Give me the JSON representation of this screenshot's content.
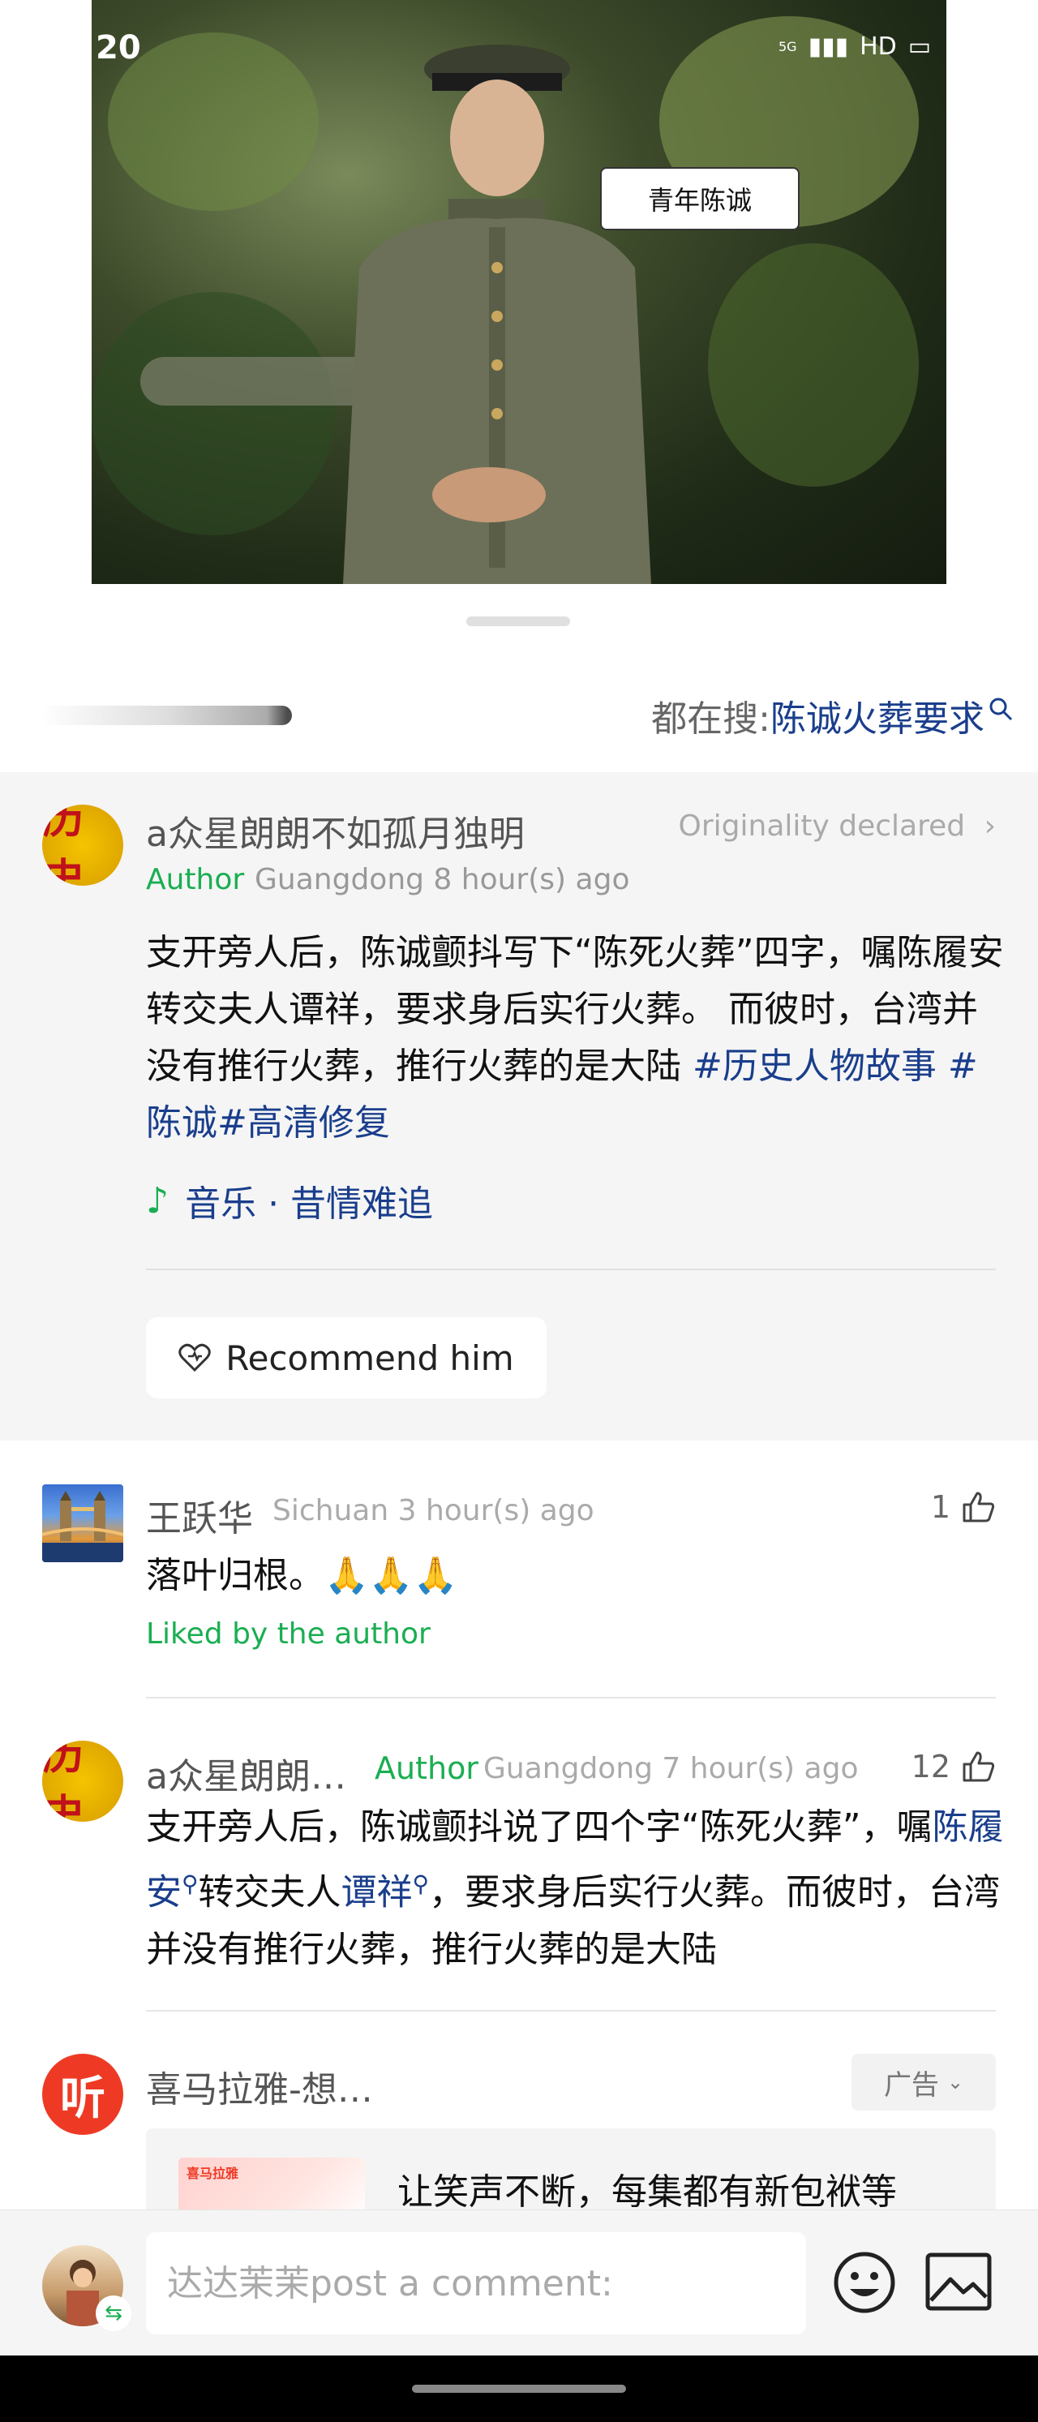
{
  "status_bar": {
    "time": "20",
    "network": "5G",
    "hd": "HD"
  },
  "video": {
    "caption": "青年陈诚"
  },
  "search": {
    "prefix": "都在搜: ",
    "query": "陈诚火葬要求",
    "icon": "search-icon"
  },
  "main_comment": {
    "name": "a众星朗朗不如孤月独明",
    "avatar_char": "历史",
    "originality": "Originality declared",
    "originality_chevron": "›",
    "author_tag": "Author",
    "meta": "Guangdong 8 hour(s) ago",
    "body_text": "支开旁人后，陈诚颤抖写下“陈死火葬”四字，嘱陈履安转交夫人谭祥，要求身后实行火葬。 而彼时，台湾并没有推行火葬，推行火葬的是大陆 ",
    "tag1": "#历史人物故事",
    "tag2": " #陈诚",
    "tag3": "#高清修复",
    "music": "音乐 · 昔情难追",
    "recommend": "Recommend him"
  },
  "comment1": {
    "name": "王跃华",
    "meta": "Sichuan 3 hour(s) ago",
    "likes": "1",
    "body": "落叶归根。🙏🙏🙏",
    "liked_by_author": "Liked by the author"
  },
  "comment2": {
    "name": "a众星朗朗…",
    "author_tag": "Author",
    "meta": "Guangdong 7 hour(s) ago",
    "likes": "12",
    "body_part1": "支开旁人后，陈诚颤抖说了四个字“陈死火葬”，嘱",
    "link1": "陈履安",
    "body_part2": "转交夫人",
    "link2": "谭祥",
    "body_part3": "，要求身后实行火葬。而彼时，台湾并没有推行火葬，推行火葬的是大陆"
  },
  "ad": {
    "name": "喜马拉雅-想…",
    "avatar_char": "听",
    "tag": "广告",
    "thumb_brand": "喜马拉雅",
    "text": "让笑声不断，每集都有新包袱等"
  },
  "bottom": {
    "placeholder": "达达茉茉post a comment:"
  }
}
